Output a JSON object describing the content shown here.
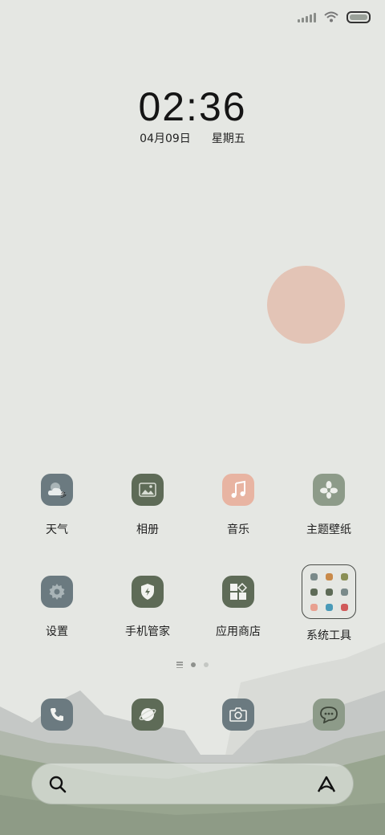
{
  "status_bar": {
    "signal_icon": "signal-icon",
    "wifi_icon": "wifi-icon",
    "battery_icon": "battery-icon"
  },
  "lockscreen": {
    "time": "02:36",
    "date": "04月09日",
    "weekday": "星期五"
  },
  "apps": [
    {
      "label": "天气",
      "icon": "weather-icon",
      "color": "#6b7a80"
    },
    {
      "label": "相册",
      "icon": "gallery-icon",
      "color": "#5e6b57"
    },
    {
      "label": "音乐",
      "icon": "music-icon",
      "color": "#e8b4a2"
    },
    {
      "label": "主题壁纸",
      "icon": "themes-icon",
      "color": "#8d9b89"
    },
    {
      "label": "设置",
      "icon": "settings-icon",
      "color": "#6b7a80"
    },
    {
      "label": "手机管家",
      "icon": "security-icon",
      "color": "#5e6b57"
    },
    {
      "label": "应用商店",
      "icon": "app-store-icon",
      "color": "#5e6b57"
    },
    {
      "label": "系统工具",
      "icon": "folder-icon",
      "color": "#4a4d49"
    }
  ],
  "folder_preview_colors": [
    "#7a8a8a",
    "#c98a4a",
    "#8a8f55",
    "#5e6b57",
    "#5e6b57",
    "#7a8a8a",
    "#e8a090",
    "#4a9ab8",
    "#d05a5a"
  ],
  "page_indicator": {
    "pages": 2,
    "active": 0
  },
  "dock": [
    {
      "icon": "phone-icon",
      "color": "#6b7a80"
    },
    {
      "icon": "browser-icon",
      "color": "#5e6b57"
    },
    {
      "icon": "camera-icon",
      "color": "#6b7a80"
    },
    {
      "icon": "messages-icon",
      "color": "#8d9b89"
    }
  ],
  "search_bar": {
    "search_icon": "search-icon",
    "assistant_icon": "assistant-icon"
  }
}
